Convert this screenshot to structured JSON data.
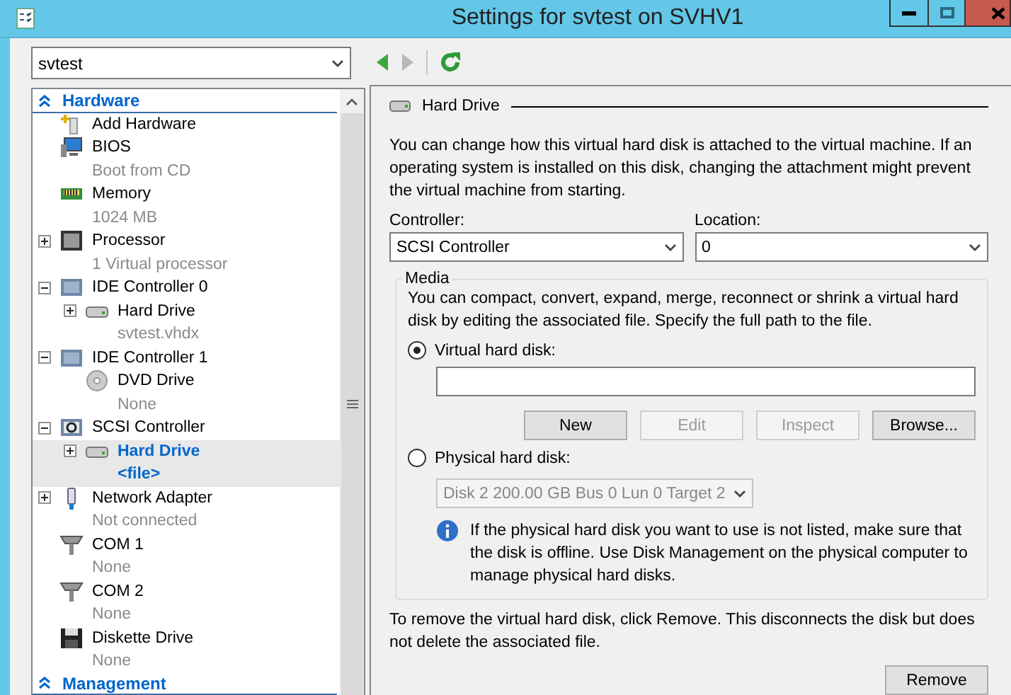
{
  "window": {
    "title": "Settings for svtest on SVHV1"
  },
  "vm_selector": {
    "value": "svtest"
  },
  "toolbar": {
    "back_enabled": true,
    "forward_enabled": false
  },
  "sidebar": {
    "sections": [
      {
        "title": "Hardware",
        "expanded": true,
        "items": [
          {
            "kind": "add",
            "name": "Add Hardware",
            "selected": false
          },
          {
            "kind": "bios",
            "name": "BIOS",
            "detail": "Boot from CD",
            "selected": false
          },
          {
            "kind": "memory",
            "name": "Memory",
            "detail": "1024 MB",
            "selected": false
          },
          {
            "kind": "processor",
            "name": "Processor",
            "detail": "1 Virtual processor",
            "expanded": false,
            "selected": false
          },
          {
            "kind": "controller",
            "name": "IDE Controller 0",
            "expanded": true,
            "selected": false,
            "children": [
              {
                "kind": "disk",
                "name": "Hard Drive",
                "detail": "svtest.vhdx",
                "expanded": false,
                "selected": false
              }
            ]
          },
          {
            "kind": "controller",
            "name": "IDE Controller 1",
            "expanded": true,
            "selected": false,
            "children": [
              {
                "kind": "dvd",
                "name": "DVD Drive",
                "detail": "None",
                "selected": false
              }
            ]
          },
          {
            "kind": "scsi",
            "name": "SCSI Controller",
            "expanded": true,
            "selected": false,
            "children": [
              {
                "kind": "disk",
                "name": "Hard Drive",
                "detail": "<file>",
                "expanded": false,
                "selected": true
              }
            ]
          },
          {
            "kind": "network",
            "name": "Network Adapter",
            "detail": "Not connected",
            "expanded": false,
            "selected": false
          },
          {
            "kind": "com",
            "name": "COM 1",
            "detail": "None",
            "selected": false
          },
          {
            "kind": "com",
            "name": "COM 2",
            "detail": "None",
            "selected": false
          },
          {
            "kind": "floppy",
            "name": "Diskette Drive",
            "detail": "None",
            "selected": false
          }
        ]
      },
      {
        "title": "Management",
        "expanded": true
      }
    ]
  },
  "panel": {
    "heading": "Hard Drive",
    "intro": "You can change how this virtual hard disk is attached to the virtual machine. If an operating system is installed on this disk, changing the attachment might prevent the virtual machine from starting.",
    "controller": {
      "label": "Controller:",
      "value": "SCSI Controller"
    },
    "location": {
      "label": "Location:",
      "value": "0"
    },
    "media": {
      "title": "Media",
      "description": "You can compact, convert, expand, merge, reconnect or shrink a virtual hard disk by editing the associated file. Specify the full path to the file.",
      "virtual": {
        "label": "Virtual hard disk:",
        "selected": true
      },
      "buttons": [
        {
          "label": "New",
          "disabled": false
        },
        {
          "label": "Edit",
          "disabled": true
        },
        {
          "label": "Inspect",
          "disabled": true
        },
        {
          "label": "Browse...",
          "disabled": false
        }
      ],
      "physical": {
        "label": "Physical hard disk:",
        "selected": false,
        "value": "Disk 2 200.00 GB Bus 0 Lun 0 Target 2",
        "disabled": true
      },
      "info": "If the physical hard disk you want to use is not listed, make sure that the disk is offline. Use Disk Management on the physical computer to manage physical hard disks."
    },
    "remove_note": "To remove the virtual hard disk, click Remove. This disconnects the disk but does not delete the associated file.",
    "remove_button": "Remove"
  }
}
